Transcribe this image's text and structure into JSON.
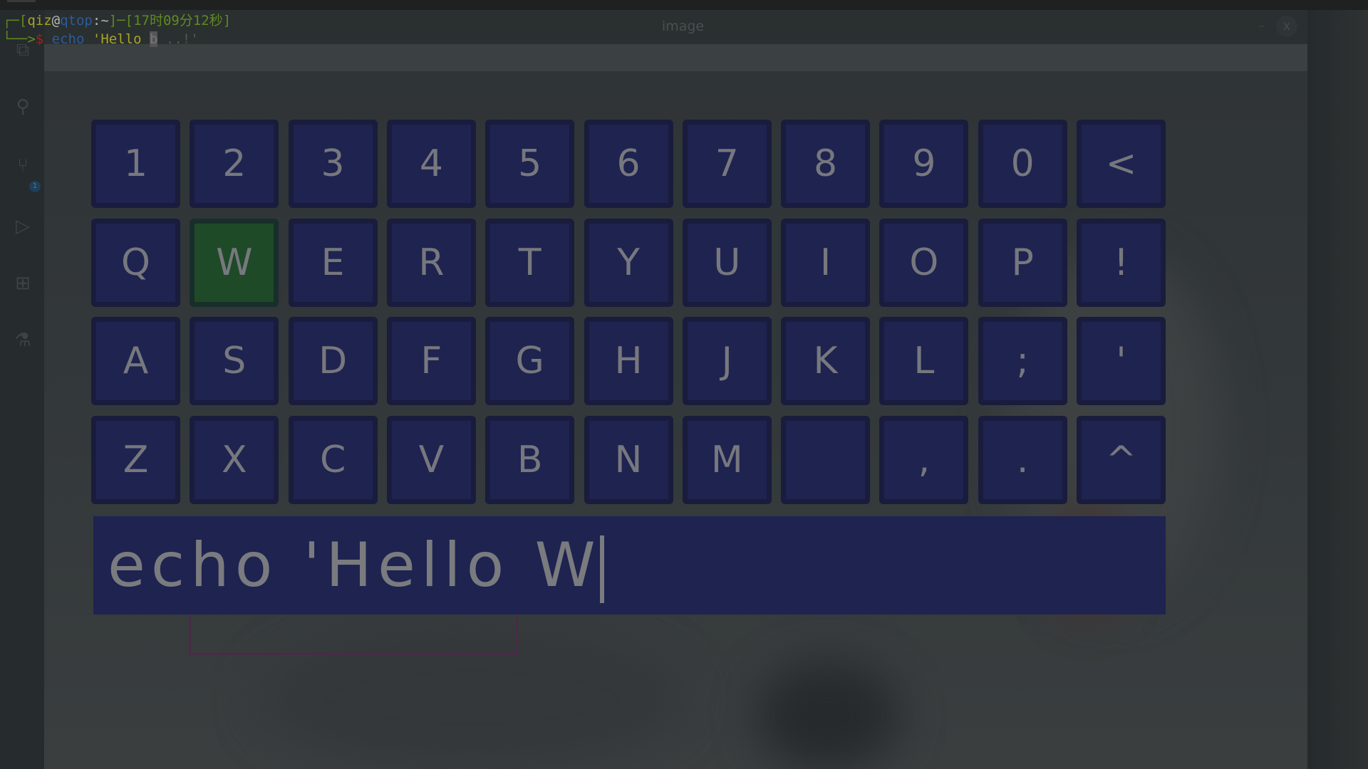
{
  "terminal": {
    "line1": {
      "bracket_open": "┌─[",
      "user": "qiz",
      "at": "@",
      "host": "qtop",
      "path": ":~",
      "bracket_close": "]─[",
      "time": "17时09分12秒",
      "end": "]"
    },
    "line2": {
      "arrow": "└──>",
      "prompt": "$",
      "command": "echo",
      "arg": "'Hello",
      "cursor_char": "b",
      "ghost": " ..!'"
    }
  },
  "window": {
    "title": "image",
    "minimize": "–",
    "close": "x"
  },
  "sidebar": {
    "badge": "1",
    "icons": [
      "files-icon",
      "search-icon",
      "source-control-icon",
      "run-debug-icon",
      "extensions-icon",
      "testing-icon"
    ]
  },
  "keyboard": {
    "rows": [
      [
        "1",
        "2",
        "3",
        "4",
        "5",
        "6",
        "7",
        "8",
        "9",
        "0",
        "<"
      ],
      [
        "Q",
        "W",
        "E",
        "R",
        "T",
        "Y",
        "U",
        "I",
        "O",
        "P",
        "!"
      ],
      [
        "A",
        "S",
        "D",
        "F",
        "G",
        "H",
        "J",
        "K",
        "L",
        ";",
        "'"
      ],
      [
        "Z",
        "X",
        "C",
        "V",
        "B",
        "N",
        "M",
        " ",
        ",",
        ".",
        "^"
      ]
    ],
    "active_key": "W",
    "colors": {
      "key": "#1f2350",
      "active": "#1e4a28",
      "text": "#77787e"
    }
  },
  "input": {
    "value": "echo 'Hello W"
  }
}
